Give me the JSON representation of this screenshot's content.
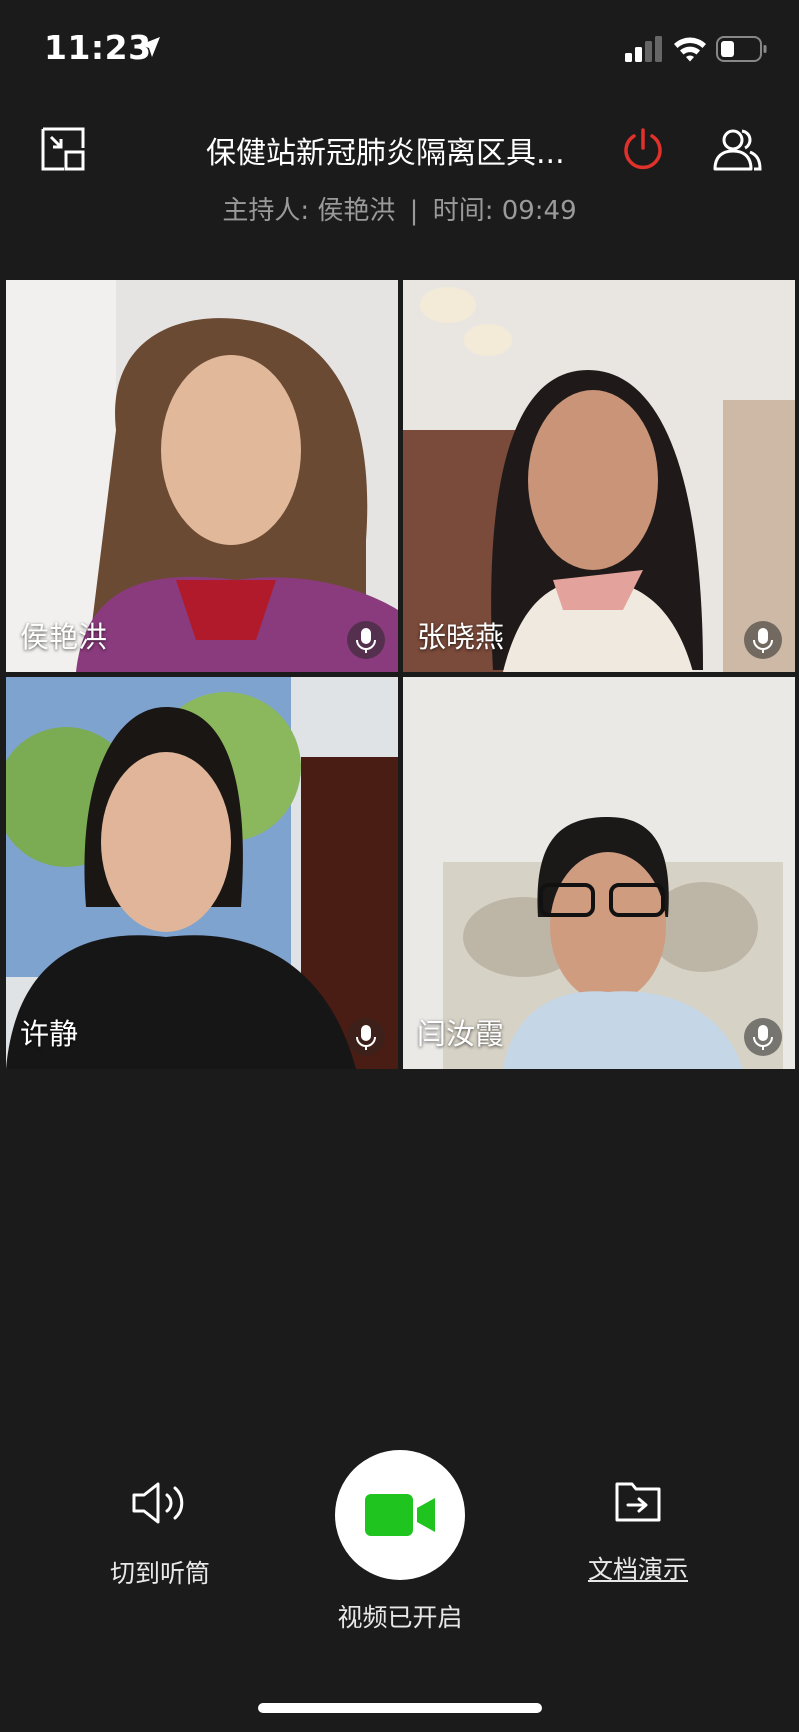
{
  "status_bar": {
    "time": "11:23",
    "icons": [
      "location-arrow-icon",
      "signal-icon",
      "wifi-icon",
      "battery-icon"
    ]
  },
  "header": {
    "title": "保健站新冠肺炎隔离区具...",
    "host_label": "主持人: 侯艳洪",
    "time_label": "时间: 09:49",
    "separator": "|",
    "icons": [
      "minimize-icon",
      "power-icon",
      "members-icon"
    ],
    "power_color": "#e0312a"
  },
  "participants": [
    {
      "name": "侯艳洪",
      "mic": "mic-icon"
    },
    {
      "name": "张晓燕",
      "mic": "mic-icon"
    },
    {
      "name": "许静",
      "mic": "mic-icon"
    },
    {
      "name": "闫汝霞",
      "mic": "mic-icon"
    }
  ],
  "controls": {
    "speaker_label": "切到听筒",
    "video_label": "视频已开启",
    "doc_label": "文档演示",
    "video_color": "#1fc41f"
  }
}
